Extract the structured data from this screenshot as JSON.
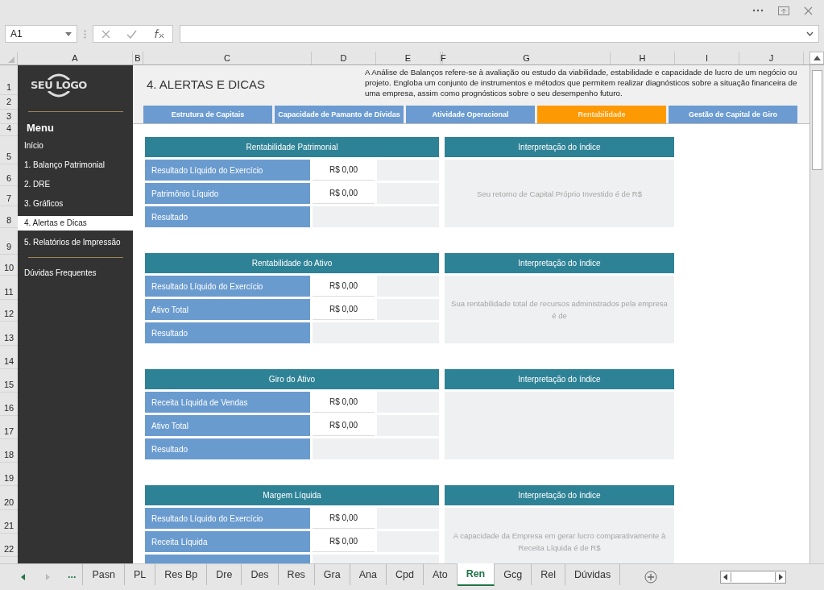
{
  "name_box": "A1",
  "column_headers": [
    "A",
    "B",
    "C",
    "D",
    "E",
    "F",
    "G",
    "H",
    "I",
    "J"
  ],
  "row_headers": [
    "1",
    "2",
    "3",
    "4",
    "5",
    "6",
    "7",
    "8",
    "9",
    "10",
    "11",
    "12",
    "13",
    "14",
    "15",
    "16",
    "17",
    "18",
    "19",
    "20",
    "21",
    "22"
  ],
  "logo": "SEU LOGO",
  "menu": {
    "title": "Menu",
    "items": [
      {
        "label": "Início",
        "selected": false
      },
      {
        "label": "1. Balanço Patrimonial",
        "selected": false
      },
      {
        "label": "2. DRE",
        "selected": false
      },
      {
        "label": "3. Gráficos",
        "selected": false
      },
      {
        "label": "4. Alertas e Dicas",
        "selected": true
      },
      {
        "label": "5. Relatórios de Impressão",
        "selected": false
      }
    ],
    "faq_item": "Dúvidas Frequentes"
  },
  "page_title": "4. ALERTAS E DICAS",
  "description": "A Análise de Balanços refere-se à avaliação ou estudo da viabilidade, estabilidade e capacidade de lucro de um negócio ou projeto. Engloba um conjunto de instrumentos e métodos que permitem realizar diagnósticos sobre a situação financeira de uma empresa, assim como prognósticos sobre o seu desempenho futuro.",
  "tabs": [
    {
      "label": "Estrutura de Capitais",
      "selected": false
    },
    {
      "label": "Capacidade de Pamanto de Dívidas",
      "selected": false
    },
    {
      "label": "Atividade Operacional",
      "selected": false
    },
    {
      "label": "Rentabilidade",
      "selected": true
    },
    {
      "label": "Gestão de Capital de Giro",
      "selected": false
    }
  ],
  "sections": [
    {
      "title": "Rentabilidade Patrimonial",
      "interp_title": "Interpretação do índice",
      "interpretation": "Seu retorno de Capital Próprio Investido é de R$",
      "rows": [
        {
          "kind": "input",
          "label": "Resultado Líquido do Exercício",
          "value": "R$ 0,00"
        },
        {
          "kind": "input",
          "label": "Patrimônio Líquido",
          "value": "R$ 0,00"
        },
        {
          "kind": "result",
          "label": "Resultado"
        }
      ]
    },
    {
      "title": "Rentabilidade do Ativo",
      "interp_title": "Interpretação do índice",
      "interpretation": "Sua rentabilidade total de recursos administrados pela empresa é de",
      "rows": [
        {
          "kind": "input",
          "label": "Resultado Líquido do Exercício",
          "value": "R$ 0,00"
        },
        {
          "kind": "input",
          "label": "Ativo Total",
          "value": "R$ 0,00"
        },
        {
          "kind": "result",
          "label": "Resultado"
        }
      ]
    },
    {
      "title": "Giro do Ativo",
      "interp_title": "Interpretação do índice",
      "rows": [
        {
          "kind": "input",
          "label": "Receita Líquida de Vendas",
          "value": "R$ 0,00"
        },
        {
          "kind": "input",
          "label": "Ativo Total",
          "value": "R$ 0,00"
        },
        {
          "kind": "result",
          "label": "Resultado"
        }
      ]
    },
    {
      "title": "Margem Líquida",
      "interp_title": "Interpretação do índice",
      "interpretation": "A capacidade da Empresa em gerar lucro comparativamente à Receita Líquida é de R$",
      "rows": [
        {
          "kind": "input",
          "label": "Resultado Líquido do Exercício",
          "value": "R$ 0,00"
        },
        {
          "kind": "input",
          "label": "Receita Líquida",
          "value": "R$ 0,00"
        },
        {
          "kind": "result"
        }
      ]
    }
  ],
  "sheet_tabs": [
    {
      "label": "...",
      "selected": false
    },
    {
      "label": "Pasn",
      "selected": false
    },
    {
      "label": "PL",
      "selected": false
    },
    {
      "label": "Res Bp",
      "selected": false
    },
    {
      "label": "Dre",
      "selected": false
    },
    {
      "label": "Des",
      "selected": false
    },
    {
      "label": "Res",
      "selected": false
    },
    {
      "label": "Gra",
      "selected": false
    },
    {
      "label": "Ana",
      "selected": false
    },
    {
      "label": "Cpd",
      "selected": false
    },
    {
      "label": "Ato",
      "selected": false
    },
    {
      "label": "Ren",
      "selected": true
    },
    {
      "label": "Gcg",
      "selected": false
    },
    {
      "label": "Rel",
      "selected": false
    },
    {
      "label": "Dúvidas",
      "selected": false
    }
  ]
}
